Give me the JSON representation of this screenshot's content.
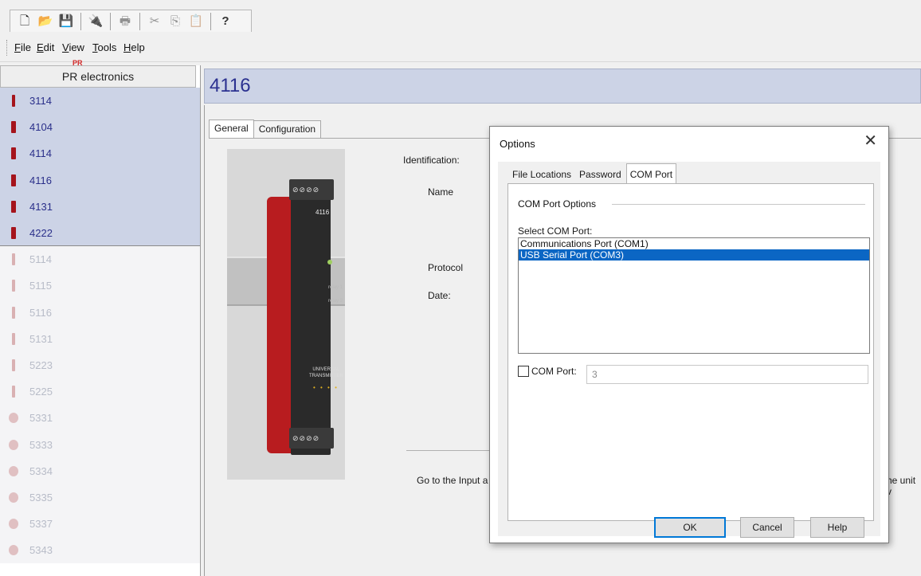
{
  "toolbar": {
    "buttons": [
      {
        "icon": "new-document-icon",
        "glyph": "🗋"
      },
      {
        "icon": "open-folder-icon",
        "glyph": "📂"
      },
      {
        "icon": "save-icon",
        "glyph": "💾"
      },
      {
        "icon": "connect-icon",
        "glyph": "🔌"
      },
      {
        "icon": "print-icon",
        "glyph": "🖶"
      },
      {
        "icon": "cut-icon",
        "glyph": "✂"
      },
      {
        "icon": "copy-icon",
        "glyph": "⎘"
      },
      {
        "icon": "paste-icon",
        "glyph": "📋"
      },
      {
        "icon": "help-icon",
        "glyph": "?"
      }
    ]
  },
  "menu": {
    "file": {
      "underline": "F",
      "rest": "ile"
    },
    "edit": {
      "underline": "E",
      "rest": "dit"
    },
    "view": {
      "underline": "V",
      "rest": "iew"
    },
    "tools": {
      "underline": "T",
      "rest": "ools"
    },
    "help": {
      "underline": "H",
      "rest": "elp"
    }
  },
  "sidebar": {
    "header": "PR electronics",
    "items": [
      {
        "label": "3114"
      },
      {
        "label": "4104"
      },
      {
        "label": "4114"
      },
      {
        "label": "4116"
      },
      {
        "label": "4131"
      },
      {
        "label": "4222"
      },
      {
        "label": "5114"
      },
      {
        "label": "5115"
      },
      {
        "label": "5116"
      },
      {
        "label": "5131"
      },
      {
        "label": "5223"
      },
      {
        "label": "5225"
      },
      {
        "label": "5331"
      },
      {
        "label": "5333"
      },
      {
        "label": "5334"
      },
      {
        "label": "5335"
      },
      {
        "label": "5337"
      },
      {
        "label": "5343"
      }
    ]
  },
  "main": {
    "title": "4116",
    "tabs": {
      "general": "General",
      "configuration": "Configuration"
    },
    "device": {
      "brand": "PR",
      "model": "4116",
      "relay1": "relay 1",
      "relay2": "relay 2",
      "label_line1": "UNIVERSAL",
      "label_line2": "TRANSMITTER"
    },
    "fields": {
      "identification": "Identification:",
      "name": "Name",
      "protocol": "Protocol",
      "date": "Date:"
    },
    "bottom_text_left": "Go to the Input a",
    "bottom_text_right": "he unit v"
  },
  "dialog": {
    "title": "Options",
    "close": "✕",
    "tabs": {
      "file_locations": "File Locations",
      "password": "Password",
      "com_port": "COM Port"
    },
    "group_title": "COM Port Options",
    "select_label": "Select COM Port:",
    "ports": [
      {
        "label": "Communications Port (COM1)",
        "selected": false
      },
      {
        "label": "USB Serial Port (COM3)",
        "selected": true
      }
    ],
    "com_port_checkbox_label": "COM Port:",
    "com_port_checked": false,
    "com_port_value": "3",
    "buttons": {
      "ok": "OK",
      "cancel": "Cancel",
      "help": "Help"
    }
  },
  "colors": {
    "accent_header": "#ccd3e6",
    "title_text": "#2b3190",
    "module_red": "#a5141c",
    "list_selection": "#0b66c4"
  }
}
